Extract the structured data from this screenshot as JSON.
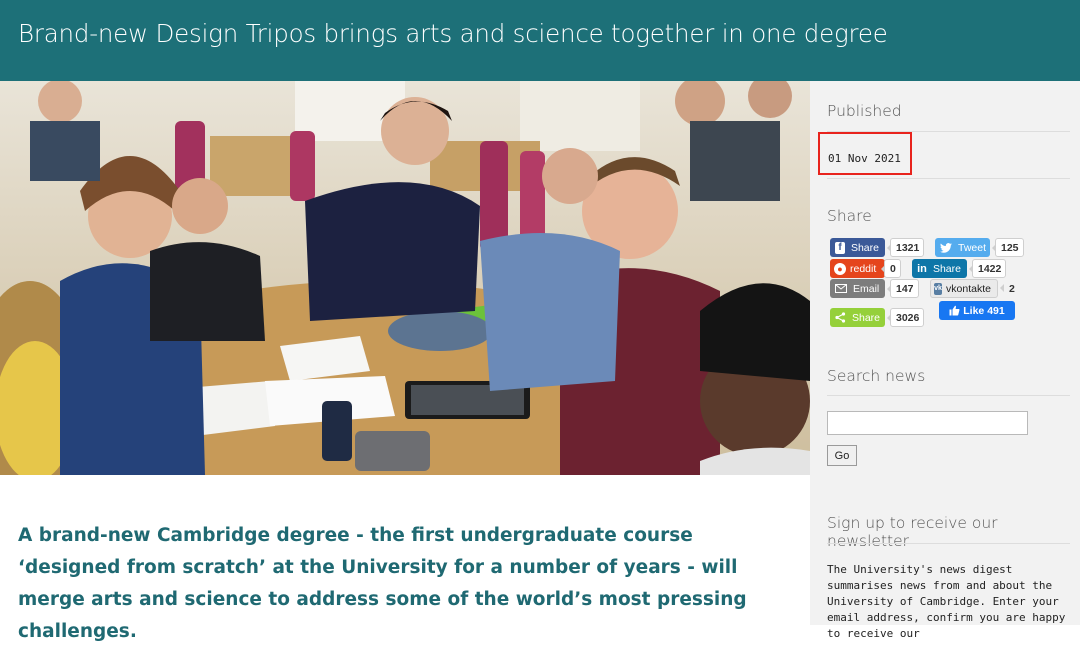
{
  "header": {
    "title": "Brand-new Design Tripos brings arts and science together in one degree"
  },
  "lead": "A brand-new Cambridge degree - the first undergraduate course ‘designed from scratch’ at the University for a number of years - will merge arts and science to address some of the world’s most pressing challenges.",
  "sidebar": {
    "published_heading": "Published",
    "published_date": "01 Nov 2021",
    "share_heading": "Share",
    "share": {
      "facebook": {
        "label": "Share",
        "count": "1321",
        "icon": "facebook-icon",
        "color": "#3b5998"
      },
      "twitter": {
        "label": "Tweet",
        "count": "125",
        "icon": "twitter-icon",
        "color": "#55acee"
      },
      "reddit": {
        "label": "reddit",
        "count": "0",
        "icon": "reddit-icon",
        "color": "#e5451c"
      },
      "linkedin": {
        "label": "Share",
        "count": "1422",
        "icon": "linkedin-icon",
        "color": "#0e76a8"
      },
      "email": {
        "label": "Email",
        "count": "147",
        "icon": "email-icon",
        "color": "#7d7d7d"
      },
      "vkontakte": {
        "label": "vkontakte",
        "count": "2",
        "icon": "vk-icon",
        "color": "#587ea3"
      },
      "sharethis": {
        "label": "Share",
        "count": "3026",
        "icon": "share-icon",
        "color": "#95d03a"
      },
      "fb_like": {
        "label": "Like 491",
        "icon": "thumbs-up-icon",
        "color": "#1877f2"
      }
    },
    "search_heading": "Search news",
    "search_button": "Go",
    "newsletter_heading": "Sign up to receive our newsletter",
    "newsletter_text": "The University's news digest summarises news from and about the University of Cambridge. Enter your email address, confirm you are happy to receive our"
  },
  "colors": {
    "header_bg": "#1d7078",
    "lead_text": "#1f6972",
    "highlight": "#e8231d"
  }
}
